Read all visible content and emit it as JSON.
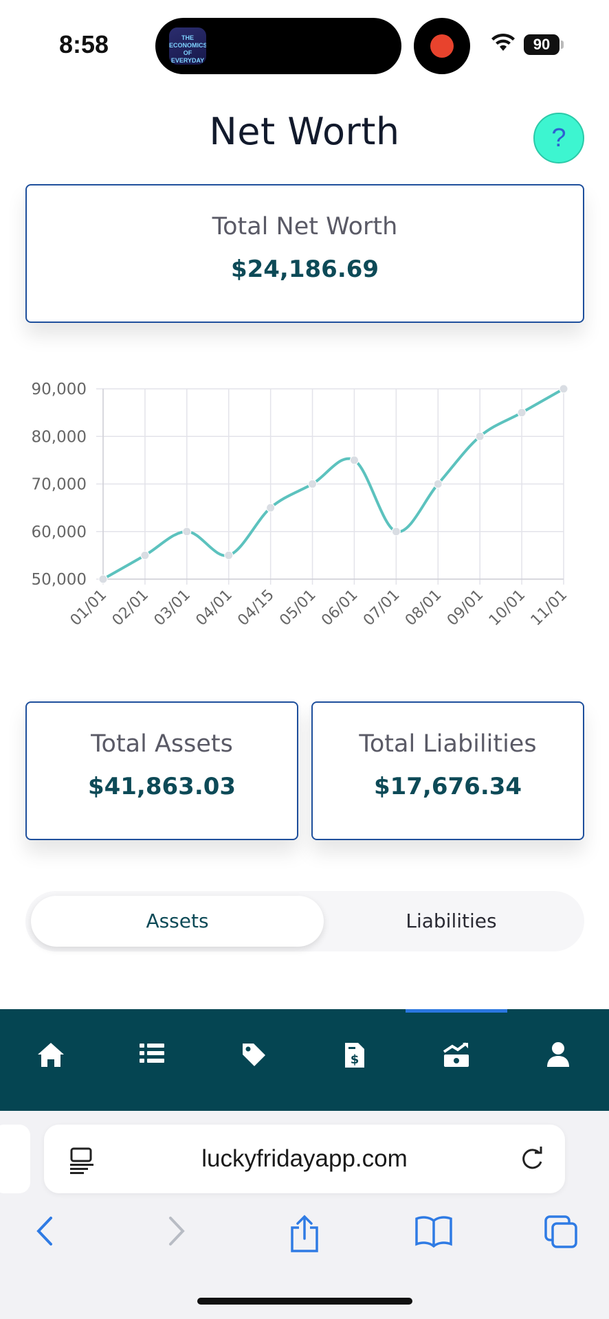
{
  "status_bar": {
    "time": "8:58",
    "battery": "90",
    "island_app_label": "THE ECONOMICS OF EVERYDAY THINGS"
  },
  "page": {
    "title": "Net Worth",
    "help_label": "?"
  },
  "net_worth_card": {
    "label": "Total Net Worth",
    "value": "$24,186.69"
  },
  "assets_card": {
    "label": "Total Assets",
    "value": "$41,863.03"
  },
  "liabilities_card": {
    "label": "Total Liabilities",
    "value": "$17,676.34"
  },
  "chart_data": {
    "type": "line",
    "categories": [
      "01/01",
      "02/01",
      "03/01",
      "04/01",
      "04/15",
      "05/01",
      "06/01",
      "07/01",
      "08/01",
      "09/01",
      "10/01",
      "11/01"
    ],
    "values": [
      50000,
      55000,
      60000,
      55000,
      65000,
      70000,
      75000,
      60000,
      70000,
      80000,
      85000,
      90000
    ],
    "y_ticks": [
      "50,000",
      "60,000",
      "70,000",
      "80,000",
      "90,000"
    ],
    "ylim": [
      50000,
      90000
    ],
    "line_color": "#5cc2be",
    "grid": true
  },
  "segmented": {
    "assets_label": "Assets",
    "liabilities_label": "Liabilities"
  },
  "nav": {
    "items": [
      "home-icon",
      "list-icon",
      "tag-icon",
      "invoice-icon",
      "investments-icon",
      "profile-icon"
    ]
  },
  "browser": {
    "url": "luckyfridayapp.com"
  },
  "colors": {
    "nav_bg": "#054552",
    "accent_value": "#0d4a57",
    "card_border": "#1e4f9c",
    "help_bg": "#3df5d0"
  }
}
